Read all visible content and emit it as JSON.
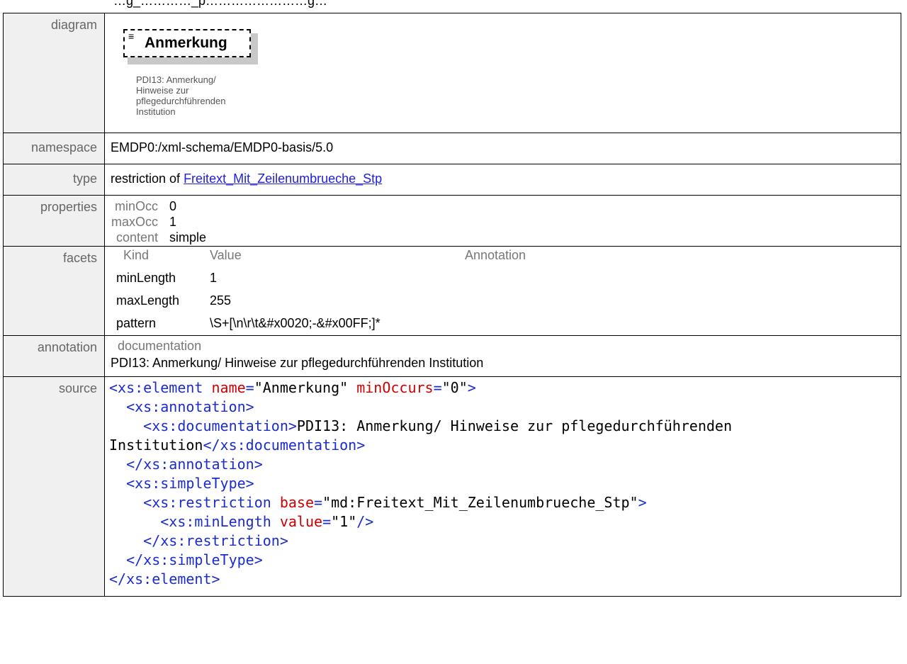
{
  "header": {
    "partial_text": "…g_…………_p……………………g…"
  },
  "labels": {
    "diagram": "diagram",
    "namespace": "namespace",
    "type": "type",
    "properties": "properties",
    "facets": "facets",
    "annotation": "annotation",
    "source": "source"
  },
  "diagram": {
    "element_name": "Anmerkung",
    "doc_lines": [
      "PDI13: Anmerkung/",
      "Hinweise zur",
      "pflegedurchführenden",
      "Institution"
    ]
  },
  "namespace": "EMDP0:/xml-schema/EMDP0-basis/5.0",
  "type": {
    "prefix": "restriction of",
    "link": "Freitext_Mit_Zeilenumbrueche_Stp"
  },
  "properties": [
    {
      "key": "minOcc",
      "value": "0"
    },
    {
      "key": "maxOcc",
      "value": "1"
    },
    {
      "key": "content",
      "value": "simple"
    }
  ],
  "facets": {
    "headers": [
      "Kind",
      "Value",
      "Annotation"
    ],
    "rows": [
      {
        "kind": "minLength",
        "value": "1"
      },
      {
        "kind": "maxLength",
        "value": "255"
      },
      {
        "kind": "pattern",
        "value": "\\S+[\\n\\r\\t&#x0020;-&#x00FF;]*"
      }
    ]
  },
  "annotation": {
    "heading": "documentation",
    "text": "PDI13: Anmerkung/ Hinweise zur pflegedurchführenden Institution"
  },
  "source": {
    "el_open": "<xs:element",
    "attr_name": "name",
    "attr_name_val": "\"Anmerkung\"",
    "attr_minocc": "minOccurs",
    "attr_minocc_val": "\"0\"",
    "close_bracket": ">",
    "ann_open": "<xs:annotation>",
    "doc_open": "<xs:documentation>",
    "doc_text1": "PDI13: Anmerkung/ Hinweise zur pflegedurchführenden",
    "doc_text2": "Institution",
    "doc_close": "</xs:documentation>",
    "ann_close": "</xs:annotation>",
    "st_open": "<xs:simpleType>",
    "res_open": "<xs:restriction",
    "attr_base": "base",
    "attr_base_val": "\"md:Freitext_Mit_Zeilenumbrueche_Stp\"",
    "ml_open": "<xs:minLength",
    "attr_value": "value",
    "attr_value_val": "\"1\"",
    "self_close": "/>",
    "res_close": "</xs:restriction>",
    "st_close": "</xs:simpleType>",
    "el_close": "</xs:element>",
    "eq": "="
  }
}
